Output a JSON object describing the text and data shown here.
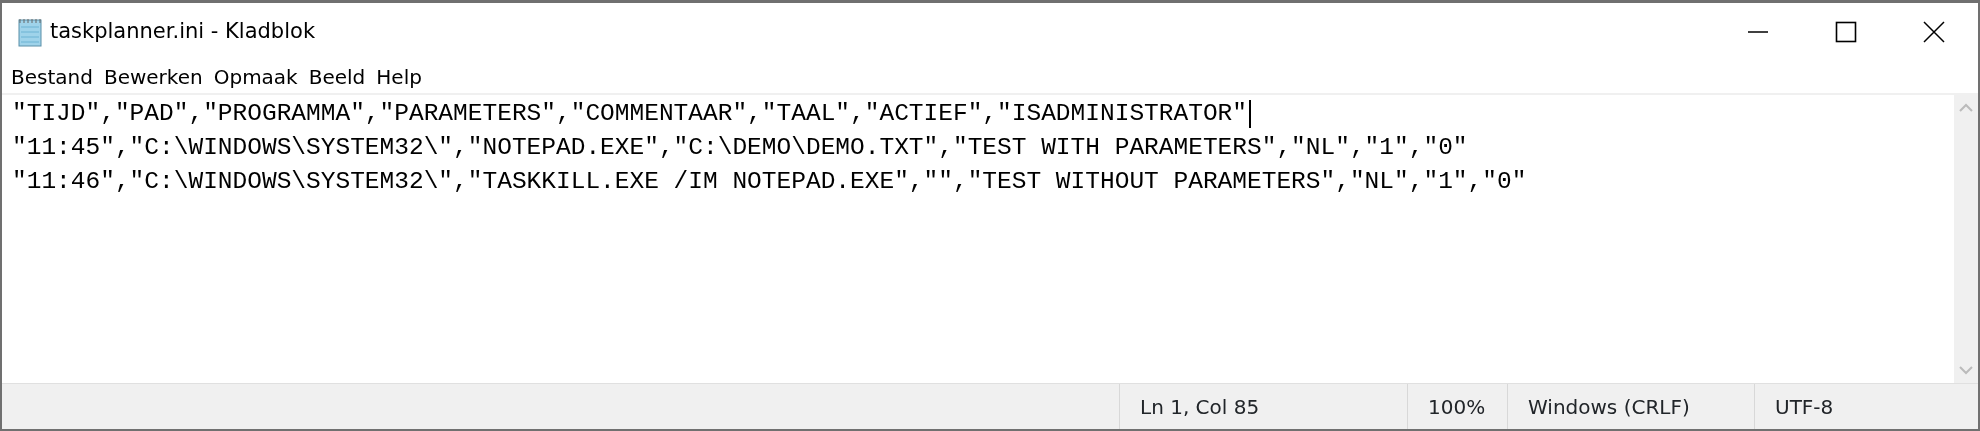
{
  "window": {
    "title": "taskplanner.ini - Kladblok"
  },
  "menu": [
    "Bestand",
    "Bewerken",
    "Opmaak",
    "Beeld",
    "Help"
  ],
  "editor": {
    "lines": [
      "\"TIJD\",\"PAD\",\"PROGRAMMA\",\"PARAMETERS\",\"COMMENTAAR\",\"TAAL\",\"ACTIEF\",\"ISADMINISTRATOR\"",
      "\"11:45\",\"C:\\WINDOWS\\SYSTEM32\\\",\"NOTEPAD.EXE\",\"C:\\DEMO\\DEMO.TXT\",\"TEST WITH PARAMETERS\",\"NL\",\"1\",\"0\"",
      "\"11:46\",\"C:\\WINDOWS\\SYSTEM32\\\",\"TASKKILL.EXE /IM NOTEPAD.EXE\",\"\",\"TEST WITHOUT PARAMETERS\",\"NL\",\"1\",\"0\""
    ]
  },
  "status_bar": [
    "Ln 1, Col 85",
    "100%",
    "Windows (CRLF)",
    "UTF-8"
  ]
}
